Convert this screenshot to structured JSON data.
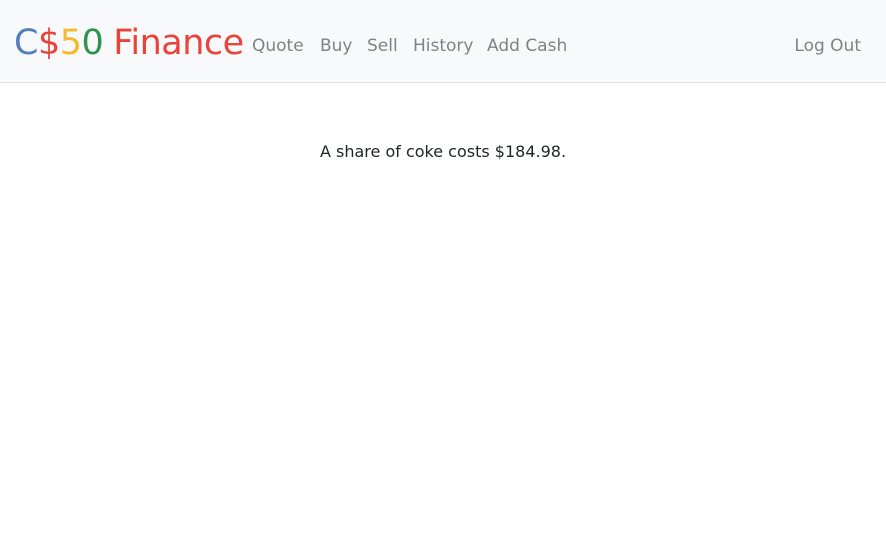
{
  "brand": {
    "parts": [
      "C",
      "$",
      "5",
      "0",
      "Finance"
    ]
  },
  "nav": {
    "items": [
      "Quote",
      "Buy",
      "Sell",
      "History",
      "Add Cash"
    ],
    "logout": "Log Out"
  },
  "main": {
    "message": "A share of coke costs $184.98."
  },
  "colors": {
    "brand_blue": "#537fbe",
    "brand_red": "#ea433b",
    "brand_yellow": "#f5b82e",
    "brand_green": "#2e944b",
    "nav_text": "#828282",
    "navbar_bg": "#f8f9fa"
  }
}
